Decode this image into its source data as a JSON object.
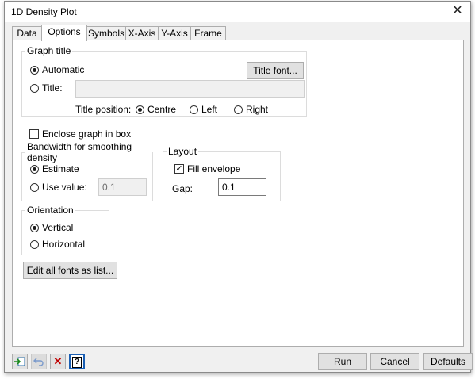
{
  "window": {
    "title": "1D Density Plot",
    "close_glyph": "✕"
  },
  "tabs": [
    {
      "label": "Data",
      "active": false
    },
    {
      "label": "Options",
      "active": true
    },
    {
      "label": "Symbols",
      "active": false
    },
    {
      "label": "X-Axis",
      "active": false
    },
    {
      "label": "Y-Axis",
      "active": false
    },
    {
      "label": "Frame",
      "active": false
    }
  ],
  "graph_title": {
    "legend": "Graph title",
    "automatic_label": "Automatic",
    "title_label": "Title:",
    "title_value": "",
    "title_font_button": "Title font...",
    "position_label": "Title position:",
    "positions": [
      "Centre",
      "Left",
      "Right"
    ],
    "selected_position": "Centre",
    "mode": "Automatic"
  },
  "enclose_box": {
    "label": "Enclose graph in box",
    "checked": false
  },
  "bandwidth": {
    "legend": "Bandwidth for smoothing density",
    "estimate_label": "Estimate",
    "use_value_label": "Use value:",
    "value": "0.1",
    "mode": "Estimate"
  },
  "layout": {
    "legend": "Layout",
    "fill_envelope_label": "Fill envelope",
    "fill_envelope_checked": true,
    "gap_label": "Gap:",
    "gap_value": "0.1"
  },
  "orientation": {
    "legend": "Orientation",
    "vertical_label": "Vertical",
    "horizontal_label": "Horizontal",
    "selected": "Vertical"
  },
  "edit_fonts_button": "Edit all fonts as list...",
  "footer": {
    "run_button": "Run",
    "cancel_button": "Cancel",
    "defaults_button": "Defaults",
    "icons": [
      "pin-icon",
      "undo-icon",
      "clear-icon",
      "help-icon"
    ],
    "help_glyph": "?"
  }
}
